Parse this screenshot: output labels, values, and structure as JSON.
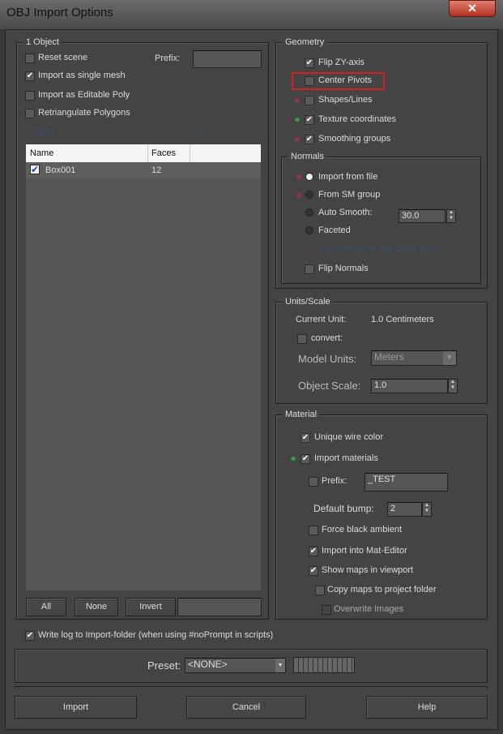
{
  "window": {
    "title": "OBJ Import Options",
    "close_icon": "close-icon"
  },
  "object_group": {
    "label": "1 Object",
    "reset_scene": {
      "label": "Reset scene",
      "checked": false
    },
    "prefix_label": "Prefix:",
    "prefix_value": "",
    "import_single_mesh": {
      "label": "Import as single mesh",
      "checked": true
    },
    "import_editable_poly": {
      "label": "Import as Editable Poly",
      "checked": false
    },
    "retriangulate": {
      "label": "Retriangulate Polygons",
      "checked": false
    },
    "info_name": "TEST",
    "info_faces": "12",
    "table": {
      "columns": [
        "Name",
        "Faces"
      ],
      "rows": [
        {
          "name": "Box001",
          "faces": "12",
          "checked": true
        }
      ]
    },
    "all_label": "All",
    "none_label": "None",
    "invert_label": "Invert",
    "filter_value": ""
  },
  "geometry": {
    "label": "Geometry",
    "flip_zy": {
      "label": "Flip ZY-axis",
      "checked": true
    },
    "center_pivots": {
      "label": "Center Pivots",
      "checked": false
    },
    "shapes_lines": {
      "label": "Shapes/Lines",
      "checked": false
    },
    "texture_coords": {
      "label": "Texture coordinates",
      "checked": true
    },
    "smoothing_groups": {
      "label": "Smoothing groups",
      "checked": true
    },
    "highlight_color": "#d02020"
  },
  "normals": {
    "label": "Normals",
    "options": [
      "Import from file",
      "From SM group",
      "Auto Smooth:",
      "Faceted"
    ],
    "selected": "Import from file",
    "auto_smooth_value": "30.0",
    "note": "(no normals in file, using sm=1)",
    "flip_normals": {
      "label": "Flip Normals",
      "checked": false
    }
  },
  "units": {
    "label": "Units/Scale",
    "current_unit_label": "Current Unit:",
    "current_unit_value": "1.0 Centimeters",
    "convert": {
      "label": "convert:",
      "checked": false
    },
    "model_units_label": "Model Units:",
    "model_units_value": "Meters",
    "object_scale_label": "Object Scale:",
    "object_scale_value": "1.0"
  },
  "material": {
    "label": "Material",
    "unique_wire": {
      "label": "Unique wire color",
      "checked": true
    },
    "import_materials": {
      "label": "Import materials",
      "checked": true
    },
    "prefix": {
      "label": "Prefix:",
      "checked": false,
      "value": "_TEST"
    },
    "default_bump_label": "Default bump:",
    "default_bump_value": "2",
    "force_black": {
      "label": "Force black ambient",
      "checked": false
    },
    "import_mat_editor": {
      "label": "Import into Mat-Editor",
      "checked": true
    },
    "show_maps": {
      "label": "Show maps in viewport",
      "checked": true
    },
    "copy_maps": {
      "label": "Copy maps to project folder",
      "checked": false
    },
    "overwrite_images": {
      "label": "Overwrite Images",
      "checked": false
    }
  },
  "write_log": {
    "label": "Write log to Import-folder (when using #noPrompt in scripts)",
    "checked": true
  },
  "preset": {
    "label": "Preset:",
    "value": "<NONE>"
  },
  "buttons": {
    "import": "Import",
    "cancel": "Cancel",
    "help": "Help"
  }
}
